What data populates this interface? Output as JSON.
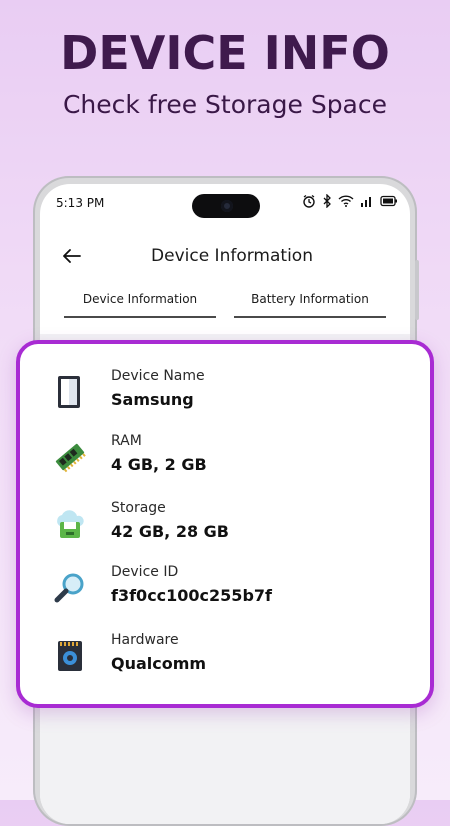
{
  "promo": {
    "headline": "DEVICE INFO",
    "subline": "Check free Storage Space"
  },
  "status_bar": {
    "time": "5:13 PM",
    "icons": [
      "alarm-icon",
      "bluetooth-icon",
      "wifi-icon",
      "signal-icon",
      "battery-icon"
    ]
  },
  "appbar": {
    "title": "Device Information",
    "back_icon": "back-arrow-icon"
  },
  "tabs": [
    {
      "label": "Device Information",
      "selected": true
    },
    {
      "label": "Battery Information",
      "selected": false
    }
  ],
  "info_card": {
    "border_color": "#a82bd3",
    "rows": [
      {
        "label": "Device Name",
        "value": "Samsung",
        "icon": "phone-icon"
      },
      {
        "label": "RAM",
        "value": "4 GB, 2 GB",
        "icon": "ram-chip-icon"
      },
      {
        "label": "Storage",
        "value": "42 GB, 28 GB",
        "icon": "cloud-storage-icon"
      },
      {
        "label": "Device ID",
        "value": "f3f0cc100c255b7f",
        "icon": "magnifier-icon"
      },
      {
        "label": "Hardware",
        "value": "Qualcomm",
        "icon": "processor-chip-icon"
      }
    ]
  },
  "colors": {
    "headline": "#3f1a4d",
    "background_top": "#e9cdf3",
    "accent": "#a82bd3"
  }
}
